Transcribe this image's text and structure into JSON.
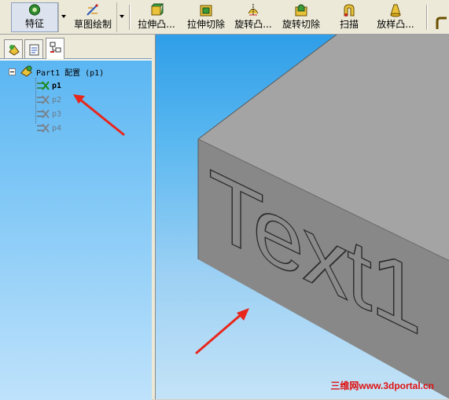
{
  "toolbar": {
    "features_label": "特征",
    "sketch_label": "草图绘制",
    "extrude_boss_label": "拉伸凸...",
    "extrude_cut_label": "拉伸切除",
    "revolve_boss_label": "旋转凸...",
    "revolve_cut_label": "旋转切除",
    "sweep_label": "扫描",
    "loft_boss_label": "放样凸..."
  },
  "tree": {
    "root_label": "Part1 配置  (p1)",
    "configs": [
      {
        "label": "p1",
        "active": true
      },
      {
        "label": "p2",
        "active": false
      },
      {
        "label": "p3",
        "active": false
      },
      {
        "label": "p4",
        "active": false
      }
    ]
  },
  "viewport": {
    "engraved_text": "Text1",
    "box_colors": {
      "top": "#a4a4a4",
      "front": "#888888",
      "right": "#8d8d8d"
    }
  },
  "annotations": {
    "arrow_color": "#e8261c"
  },
  "watermark": "三维网www.3dportal.cn"
}
